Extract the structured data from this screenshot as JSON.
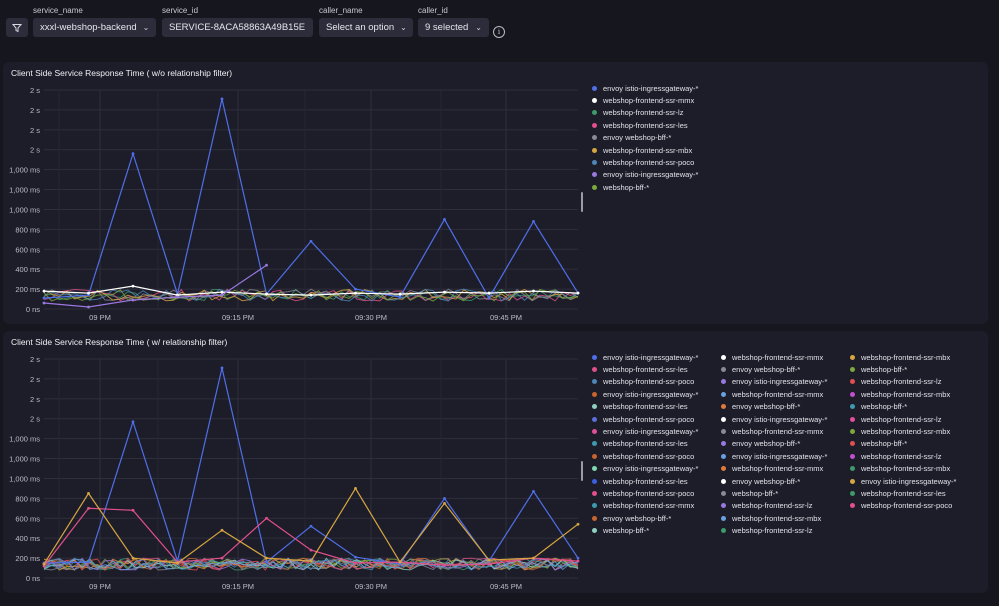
{
  "variables": {
    "service_name": {
      "label": "service_name",
      "value": "xxxl-webshop-backend"
    },
    "service_id": {
      "label": "service_id",
      "value": "SERVICE-8ACA58863A49B15E"
    },
    "caller_name": {
      "label": "caller_name",
      "value": "Select an option"
    },
    "caller_id": {
      "label": "caller_id",
      "value": "9 selected"
    }
  },
  "panels": [
    {
      "title": "Client Side Service Response Time ( w/o relationship filter)",
      "yticks": [
        "2 s",
        "2 s",
        "2 s",
        "2 s",
        "1,000 ms",
        "1,000 ms",
        "1,000 ms",
        "800 ms",
        "600 ms",
        "400 ms",
        "200 ms",
        "0 ns"
      ],
      "xticks": [
        "09 PM",
        "09:15 PM",
        "09:30 PM",
        "09:45 PM"
      ],
      "legend": [
        {
          "name": "envoy istio-ingressgateway-*",
          "color": "#4f6fe8"
        },
        {
          "name": "webshop-frontend-ssr-mmx",
          "color": "#ffffff"
        },
        {
          "name": "webshop-frontend-ssr-lz",
          "color": "#3e9a6a"
        },
        {
          "name": "webshop-frontend-ssr-les",
          "color": "#e0508a"
        },
        {
          "name": "envoy webshop-bff-*",
          "color": "#8a8a95"
        },
        {
          "name": "webshop-frontend-ssr-mbx",
          "color": "#d7a640"
        },
        {
          "name": "webshop-frontend-ssr-poco",
          "color": "#4d87b8"
        },
        {
          "name": "envoy istio-ingressgateway-*",
          "color": "#9a78e0"
        },
        {
          "name": "webshop-bff-*",
          "color": "#7ca83c"
        }
      ]
    },
    {
      "title": "Client Side Service Response Time ( w/ relationship filter)",
      "yticks": [
        "2 s",
        "2 s",
        "2 s",
        "2 s",
        "1,000 ms",
        "1,000 ms",
        "1,000 ms",
        "800 ms",
        "600 ms",
        "400 ms",
        "200 ms",
        "0 ns"
      ],
      "xticks": [
        "09 PM",
        "09:15 PM",
        "09:30 PM",
        "09:45 PM"
      ],
      "legend": [
        {
          "name": "envoy istio-ingressgateway-*",
          "color": "#4f6fe8"
        },
        {
          "name": "webshop-frontend-ssr-les",
          "color": "#e0508a"
        },
        {
          "name": "webshop-frontend-ssr-poco",
          "color": "#4d87b8"
        },
        {
          "name": "envoy istio-ingressgateway-*",
          "color": "#c8642e"
        },
        {
          "name": "webshop-frontend-ssr-les",
          "color": "#8fd0c0"
        },
        {
          "name": "webshop-frontend-ssr-poco",
          "color": "#5c6ed8"
        },
        {
          "name": "envoy istio-ingressgateway-*",
          "color": "#e04f9a"
        },
        {
          "name": "webshop-frontend-ssr-les",
          "color": "#3e9ab0"
        },
        {
          "name": "webshop-frontend-ssr-poco",
          "color": "#c8642e"
        },
        {
          "name": "envoy istio-ingressgateway-*",
          "color": "#7fd8b0"
        },
        {
          "name": "webshop-frontend-ssr-les",
          "color": "#3a5fe0"
        },
        {
          "name": "webshop-frontend-ssr-poco",
          "color": "#e0508a"
        },
        {
          "name": "webshop-frontend-ssr-mmx",
          "color": "#3e9ab0"
        },
        {
          "name": "envoy webshop-bff-*",
          "color": "#c8642e"
        },
        {
          "name": "webshop-bff-*",
          "color": "#8fd0c0"
        },
        {
          "name": "webshop-frontend-ssr-mmx",
          "color": "#ffffff"
        },
        {
          "name": "envoy webshop-bff-*",
          "color": "#8a8a95"
        },
        {
          "name": "envoy istio-ingressgateway-*",
          "color": "#9a78e0"
        },
        {
          "name": "webshop-frontend-ssr-mmx",
          "color": "#6aa0e0"
        },
        {
          "name": "envoy webshop-bff-*",
          "color": "#e07a3a"
        },
        {
          "name": "envoy istio-ingressgateway-*",
          "color": "#ffffff"
        },
        {
          "name": "webshop-frontend-ssr-mmx",
          "color": "#8a8a95"
        },
        {
          "name": "envoy webshop-bff-*",
          "color": "#9a78e0"
        },
        {
          "name": "envoy istio-ingressgateway-*",
          "color": "#6aa0e0"
        },
        {
          "name": "webshop-frontend-ssr-mmx",
          "color": "#e07a3a"
        },
        {
          "name": "envoy webshop-bff-*",
          "color": "#ffffff"
        },
        {
          "name": "webshop-bff-*",
          "color": "#8a8a95"
        },
        {
          "name": "webshop-frontend-ssr-lz",
          "color": "#9a78e0"
        },
        {
          "name": "webshop-frontend-ssr-mbx",
          "color": "#6aa0e0"
        },
        {
          "name": "webshop-frontend-ssr-lz",
          "color": "#3e9a6a"
        },
        {
          "name": "webshop-frontend-ssr-mbx",
          "color": "#d7a640"
        },
        {
          "name": "webshop-bff-*",
          "color": "#7ca83c"
        },
        {
          "name": "webshop-frontend-ssr-lz",
          "color": "#e05050"
        },
        {
          "name": "webshop-frontend-ssr-mbx",
          "color": "#c050d0"
        },
        {
          "name": "webshop-bff-*",
          "color": "#3e9ab0"
        },
        {
          "name": "webshop-frontend-ssr-lz",
          "color": "#e04f9a"
        },
        {
          "name": "webshop-frontend-ssr-mbx",
          "color": "#7ca83c"
        },
        {
          "name": "webshop-bff-*",
          "color": "#e05050"
        },
        {
          "name": "webshop-frontend-ssr-lz",
          "color": "#c050d0"
        },
        {
          "name": "webshop-frontend-ssr-mbx",
          "color": "#3e9a6a"
        },
        {
          "name": "envoy istio-ingressgateway-*",
          "color": "#d7a640"
        },
        {
          "name": "webshop-frontend-ssr-les",
          "color": "#3e9a6a"
        },
        {
          "name": "webshop-frontend-ssr-poco",
          "color": "#e0508a"
        }
      ]
    }
  ],
  "chart_data": [
    {
      "type": "line",
      "title": "Client Side Service Response Time ( w/o relationship filter)",
      "x": [
        "08:53 PM",
        "09 PM",
        "09:05 PM",
        "09:10 PM",
        "09:15 PM",
        "09:20 PM",
        "09:25 PM",
        "09:30 PM",
        "09:35 PM",
        "09:40 PM",
        "09:45 PM",
        "09:50 PM",
        "09:54 PM"
      ],
      "series": [
        {
          "name": "envoy istio-ingressgateway-*",
          "values": [
            110,
            140,
            1560,
            150,
            2110,
            150,
            680,
            200,
            120,
            900,
            110,
            880,
            160
          ],
          "unit": "ms"
        },
        {
          "name": "webshop-frontend-ssr-mmx",
          "values": [
            180,
            160,
            230,
            140,
            170,
            150,
            140,
            160,
            150,
            170,
            160,
            180,
            160
          ],
          "unit": "ms"
        },
        {
          "name": "envoy istio-ingressgateway-*",
          "values": [
            60,
            20,
            90,
            120,
            140,
            440,
            null,
            null,
            null,
            null,
            null,
            null,
            null
          ],
          "unit": "ms"
        }
      ]
    },
    {
      "type": "line",
      "title": "Client Side Service Response Time ( w/ relationship filter)",
      "x": [
        "08:53 PM",
        "09 PM",
        "09:05 PM",
        "09:10 PM",
        "09:15 PM",
        "09:20 PM",
        "09:25 PM",
        "09:30 PM",
        "09:35 PM",
        "09:40 PM",
        "09:45 PM",
        "09:50 PM",
        "09:54 PM"
      ],
      "series": [
        {
          "name": "envoy istio-ingressgateway-*",
          "values": [
            150,
            160,
            1570,
            170,
            2110,
            160,
            520,
            210,
            140,
            800,
            170,
            870,
            200
          ],
          "unit": "ms"
        },
        {
          "name": "webshop-frontend-ssr-les",
          "values": [
            120,
            700,
            680,
            160,
            200,
            600,
            280,
            150,
            160,
            130,
            140,
            200,
            170
          ],
          "unit": "ms"
        },
        {
          "name": "envoy istio-ingressgateway-*",
          "values": [
            140,
            850,
            200,
            150,
            480,
            200,
            170,
            900,
            160,
            750,
            180,
            200,
            540
          ],
          "unit": "ms"
        }
      ]
    }
  ]
}
